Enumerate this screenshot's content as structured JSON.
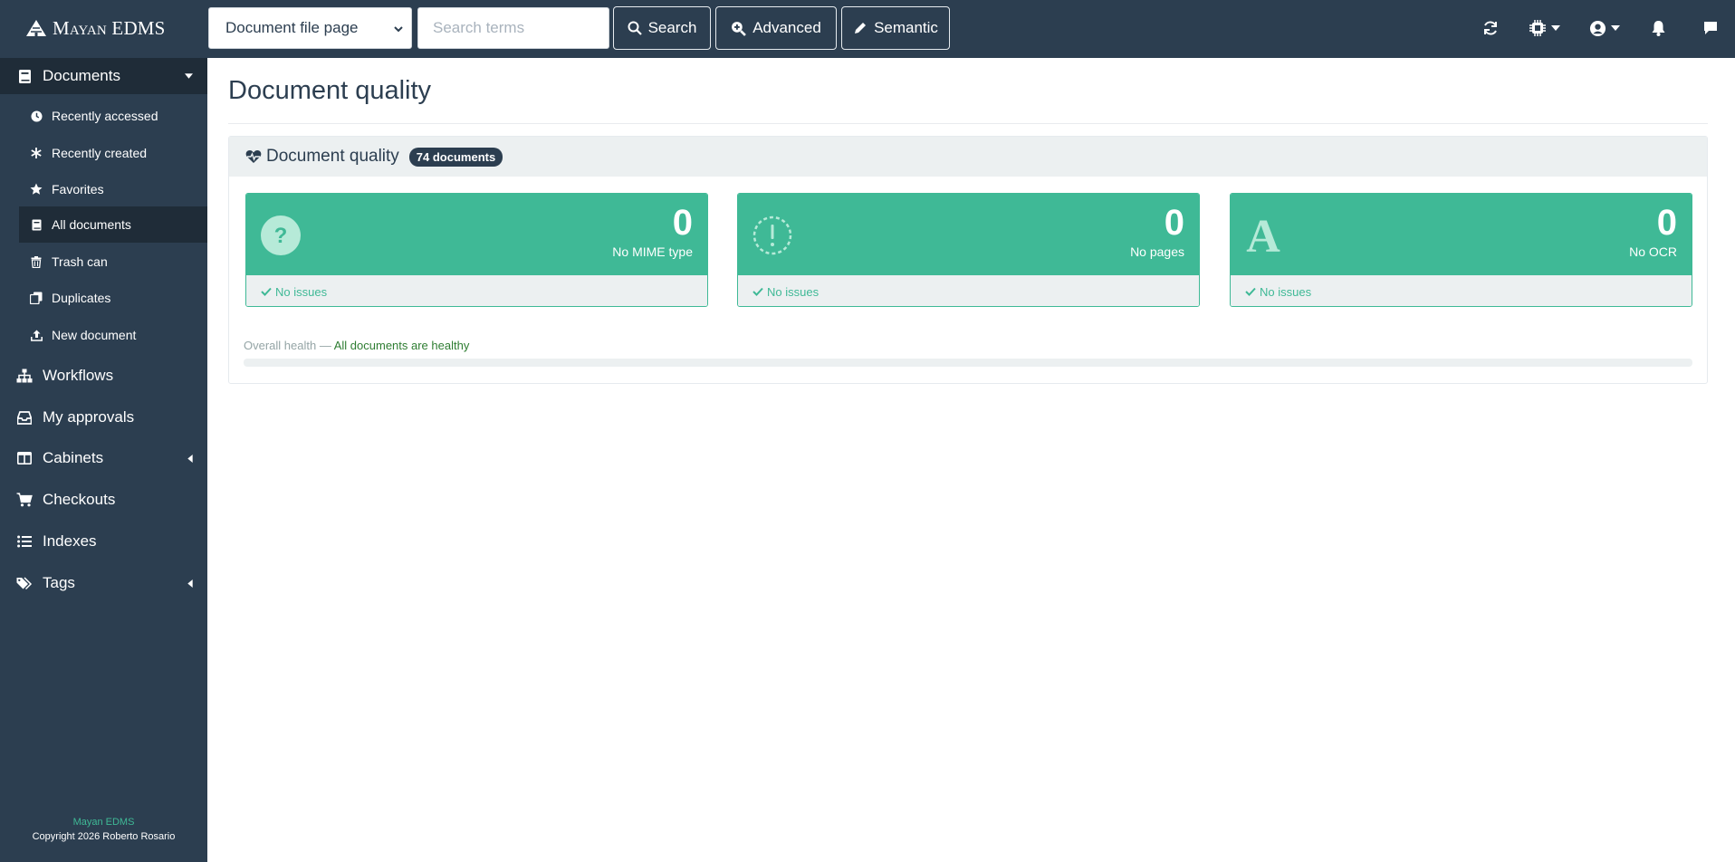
{
  "brand": {
    "name": "Mayan EDMS"
  },
  "topbar": {
    "search_scope": "Document file page",
    "search_placeholder": "Search terms",
    "search_label": "Search",
    "advanced_label": "Advanced",
    "semantic_label": "Semantic"
  },
  "sidebar": {
    "documents": "Documents",
    "sub": {
      "recently_accessed": "Recently accessed",
      "recently_created": "Recently created",
      "favorites": "Favorites",
      "all_documents": "All documents",
      "trash_can": "Trash can",
      "duplicates": "Duplicates",
      "new_document": "New document"
    },
    "workflows": "Workflows",
    "my_approvals": "My approvals",
    "cabinets": "Cabinets",
    "checkouts": "Checkouts",
    "indexes": "Indexes",
    "tags": "Tags",
    "footer_app": "Mayan EDMS",
    "footer_copyright": "Copyright 2026 Roberto Rosario"
  },
  "main": {
    "title": "Document quality",
    "panel_title": "Document quality",
    "badge": "74 documents",
    "cards": [
      {
        "count": "0",
        "label": "No MIME type",
        "status": "No issues",
        "icon": "question-circle-icon"
      },
      {
        "count": "0",
        "label": "No pages",
        "status": "No issues",
        "icon": "exclamation-dashed-circle-icon"
      },
      {
        "count": "0",
        "label": "No OCR",
        "status": "No issues",
        "icon": "letter-a-icon"
      }
    ],
    "health_label": "Overall health —",
    "health_value": "All documents are healthy"
  },
  "colors": {
    "navbar": "#2c3e50",
    "accent": "#3fb996",
    "panel_bg": "#ecf0f1"
  }
}
